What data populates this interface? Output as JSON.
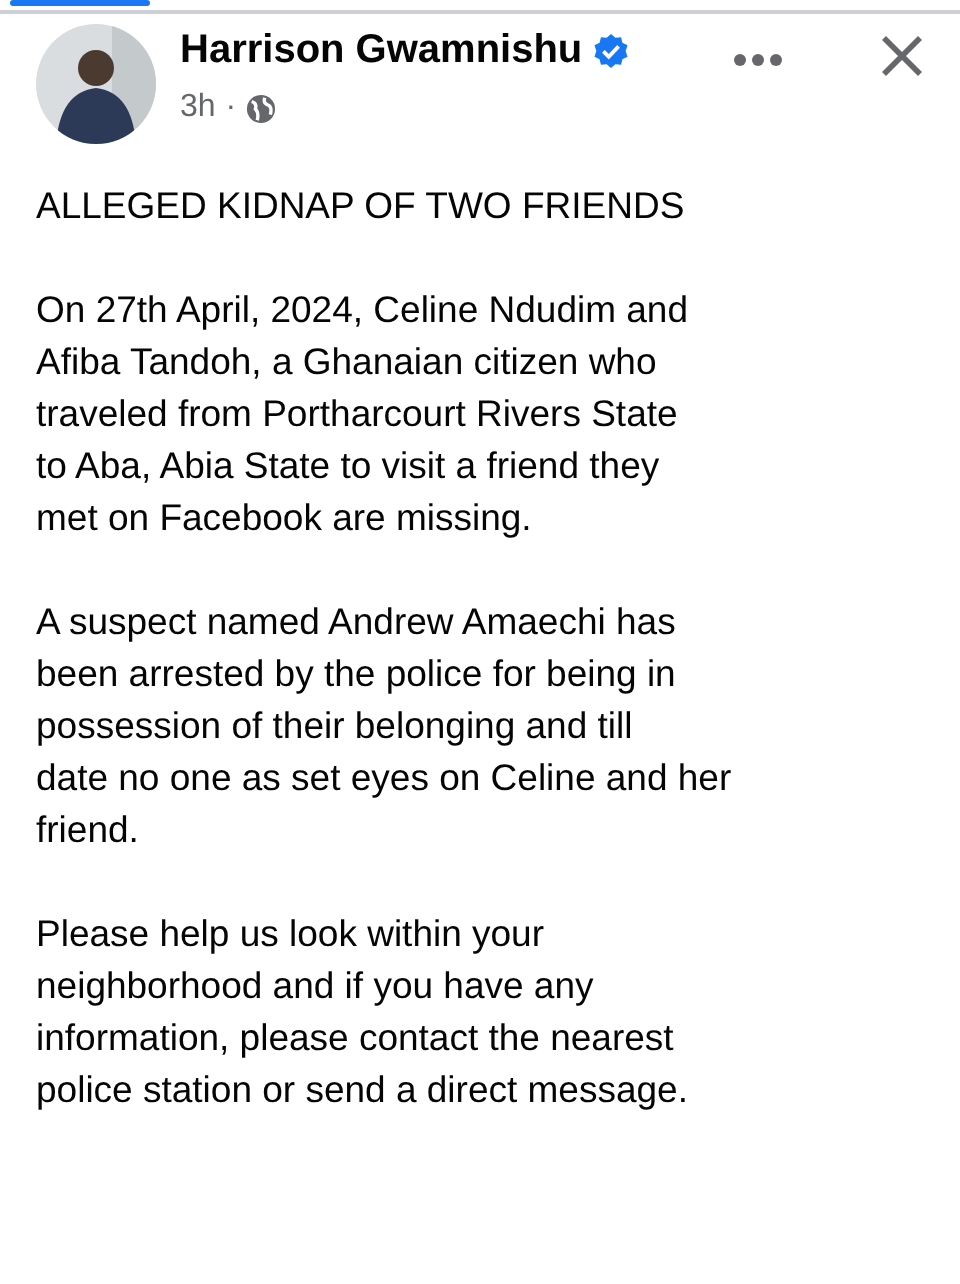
{
  "tab_indicator": {
    "selected": true
  },
  "post": {
    "author": "Harrison Gwamnishu",
    "verified": true,
    "time": "3h",
    "separator": "·",
    "paragraphs": [
      [
        "ALLEGED KIDNAP OF TWO FRIENDS"
      ],
      [
        "On 27th April, 2024, Celine Ndudim and",
        "Afiba Tandoh, a Ghanaian citizen who",
        "traveled from Portharcourt Rivers State",
        "to Aba, Abia State to visit a friend they",
        "met on Facebook are missing."
      ],
      [
        "A suspect named Andrew Amaechi has",
        "been arrested by the police for being in",
        "possession of their belonging and till",
        "date no one as set eyes on Celine and her",
        "friend."
      ],
      [
        "Please help us look within your",
        "neighborhood and if you have any",
        "information, please contact the nearest",
        "police station or send a direct message."
      ]
    ]
  }
}
